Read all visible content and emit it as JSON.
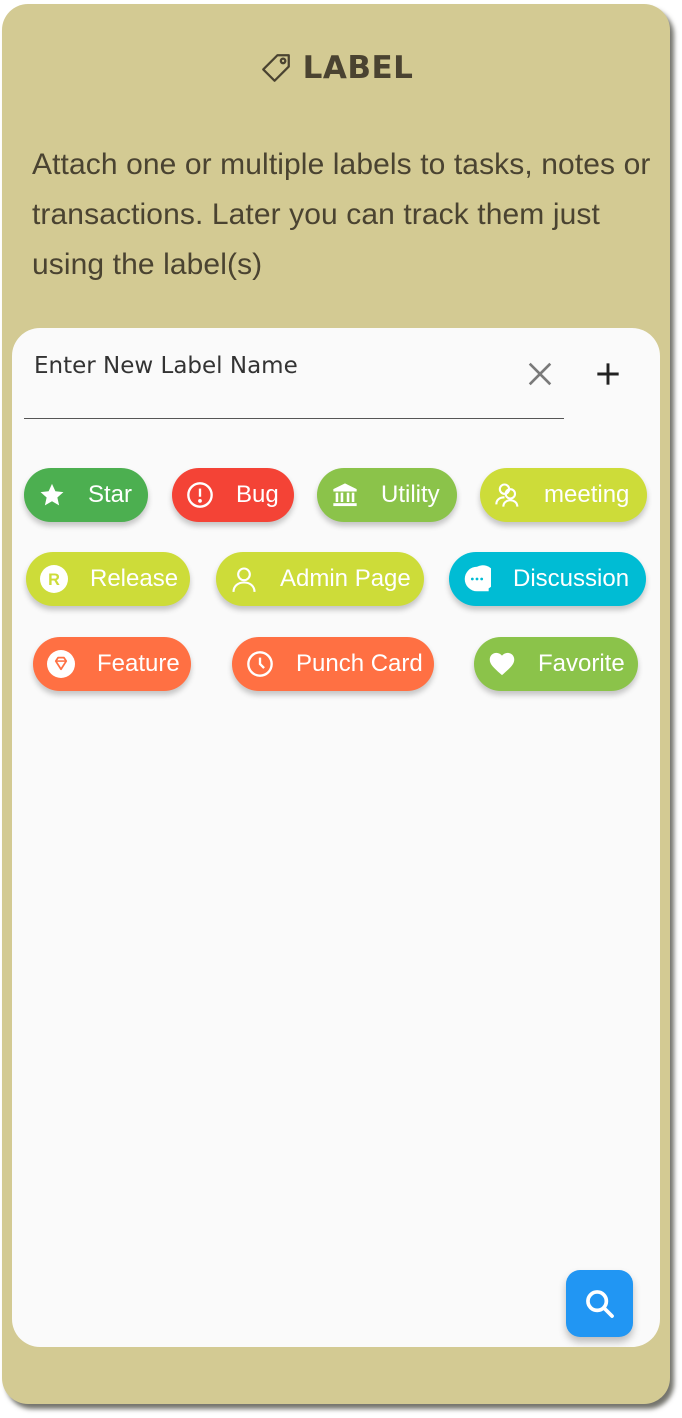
{
  "header": {
    "icon": "tag-icon",
    "title": "LABEL"
  },
  "description": "Attach one or multiple labels to tasks, notes or transactions. Later you can track them just using the label(s)",
  "input": {
    "placeholder": "Enter New Label Name",
    "value": "",
    "clear_icon": "close-icon",
    "add_icon": "plus-icon"
  },
  "colors": {
    "frame": "#d3ca93",
    "panel": "#fafafa",
    "text": "#4a4331",
    "fab": "#2196f3"
  },
  "labels": [
    {
      "name": "Star",
      "icon": "star-icon",
      "color": "#4caf50"
    },
    {
      "name": "Bug",
      "icon": "alert-circle-icon",
      "color": "#f44336"
    },
    {
      "name": "Utility",
      "icon": "bank-icon",
      "color": "#8bc34a"
    },
    {
      "name": "meeting",
      "icon": "people-icon",
      "color": "#cddc39"
    },
    {
      "name": "Release",
      "icon": "r-circle-icon",
      "color": "#cddc39"
    },
    {
      "name": "Admin Page",
      "icon": "person-icon",
      "color": "#cddc39"
    },
    {
      "name": "Discussion",
      "icon": "chat-bubble-icon",
      "color": "#00bcd4"
    },
    {
      "name": "Feature",
      "icon": "diamond-icon",
      "color": "#ff7043"
    },
    {
      "name": "Punch Card",
      "icon": "clock-icon",
      "color": "#ff7043"
    },
    {
      "name": "Favorite",
      "icon": "heart-icon",
      "color": "#8bc34a"
    }
  ],
  "fab": {
    "icon": "search-icon"
  }
}
